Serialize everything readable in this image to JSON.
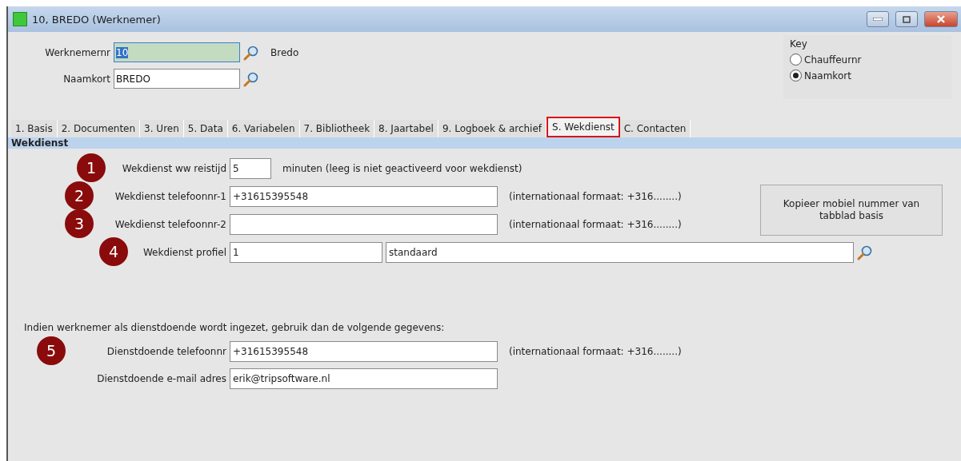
{
  "window": {
    "title": "10, BREDO (Werknemer)"
  },
  "header": {
    "fields": [
      {
        "label": "Werknemernr",
        "value": "10",
        "selected": true,
        "lookup": true,
        "name": "Bredo"
      },
      {
        "label": "Naamkort",
        "value": "BREDO",
        "selected": false,
        "lookup": true
      }
    ],
    "key": {
      "title": "Key",
      "options": [
        {
          "label": "Chauffeurnr",
          "selected": false
        },
        {
          "label": "Naamkort",
          "selected": true
        }
      ]
    }
  },
  "tabs": [
    {
      "label": "1. Basis",
      "selected": false
    },
    {
      "label": "2. Documenten",
      "selected": false
    },
    {
      "label": "3. Uren",
      "selected": false
    },
    {
      "label": "5. Data",
      "selected": false
    },
    {
      "label": "6. Variabelen",
      "selected": false
    },
    {
      "label": "7. Bibliotheek",
      "selected": false
    },
    {
      "label": "8. Jaartabel",
      "selected": false
    },
    {
      "label": "9. Logboek & archief",
      "selected": false
    },
    {
      "label": "S. Wekdienst",
      "selected": true
    },
    {
      "label": "C. Contacten",
      "selected": false
    }
  ],
  "section": {
    "title": "Wekdienst",
    "rows": [
      {
        "kind": "short",
        "callout": "1",
        "label": "Wekdienst ww reistijd",
        "value": "5",
        "hint": "minuten (leeg is niet geactiveerd voor wekdienst)"
      },
      {
        "kind": "phone",
        "callout": "2",
        "label": "Wekdienst telefoonnr-1",
        "value": "+31615395548",
        "hint": "(internationaal formaat: +316........)"
      },
      {
        "kind": "phone",
        "callout": "3",
        "label": "Wekdienst telefoonnr-2",
        "value": "",
        "hint": "(internationaal formaat: +316........)"
      },
      {
        "kind": "lookup",
        "callout": "4",
        "label": "Wekdienst profiel",
        "value": "1",
        "value_2": "standaard"
      }
    ],
    "copy_button": "Kopieer mobiel nummer van tabblad basis",
    "info": "Indien werknemer als dienstdoende wordt ingezet, gebruik dan de volgende gegevens:",
    "rows_2": [
      {
        "kind": "phone",
        "callout": "5",
        "label": "Dienstdoende telefoonnr",
        "value": "+31615395548",
        "hint": "(internationaal formaat: +316........)"
      },
      {
        "kind": "phone",
        "label": "Dienstdoende e-mail adres",
        "value": "erik@tripsoftware.nl"
      }
    ]
  }
}
